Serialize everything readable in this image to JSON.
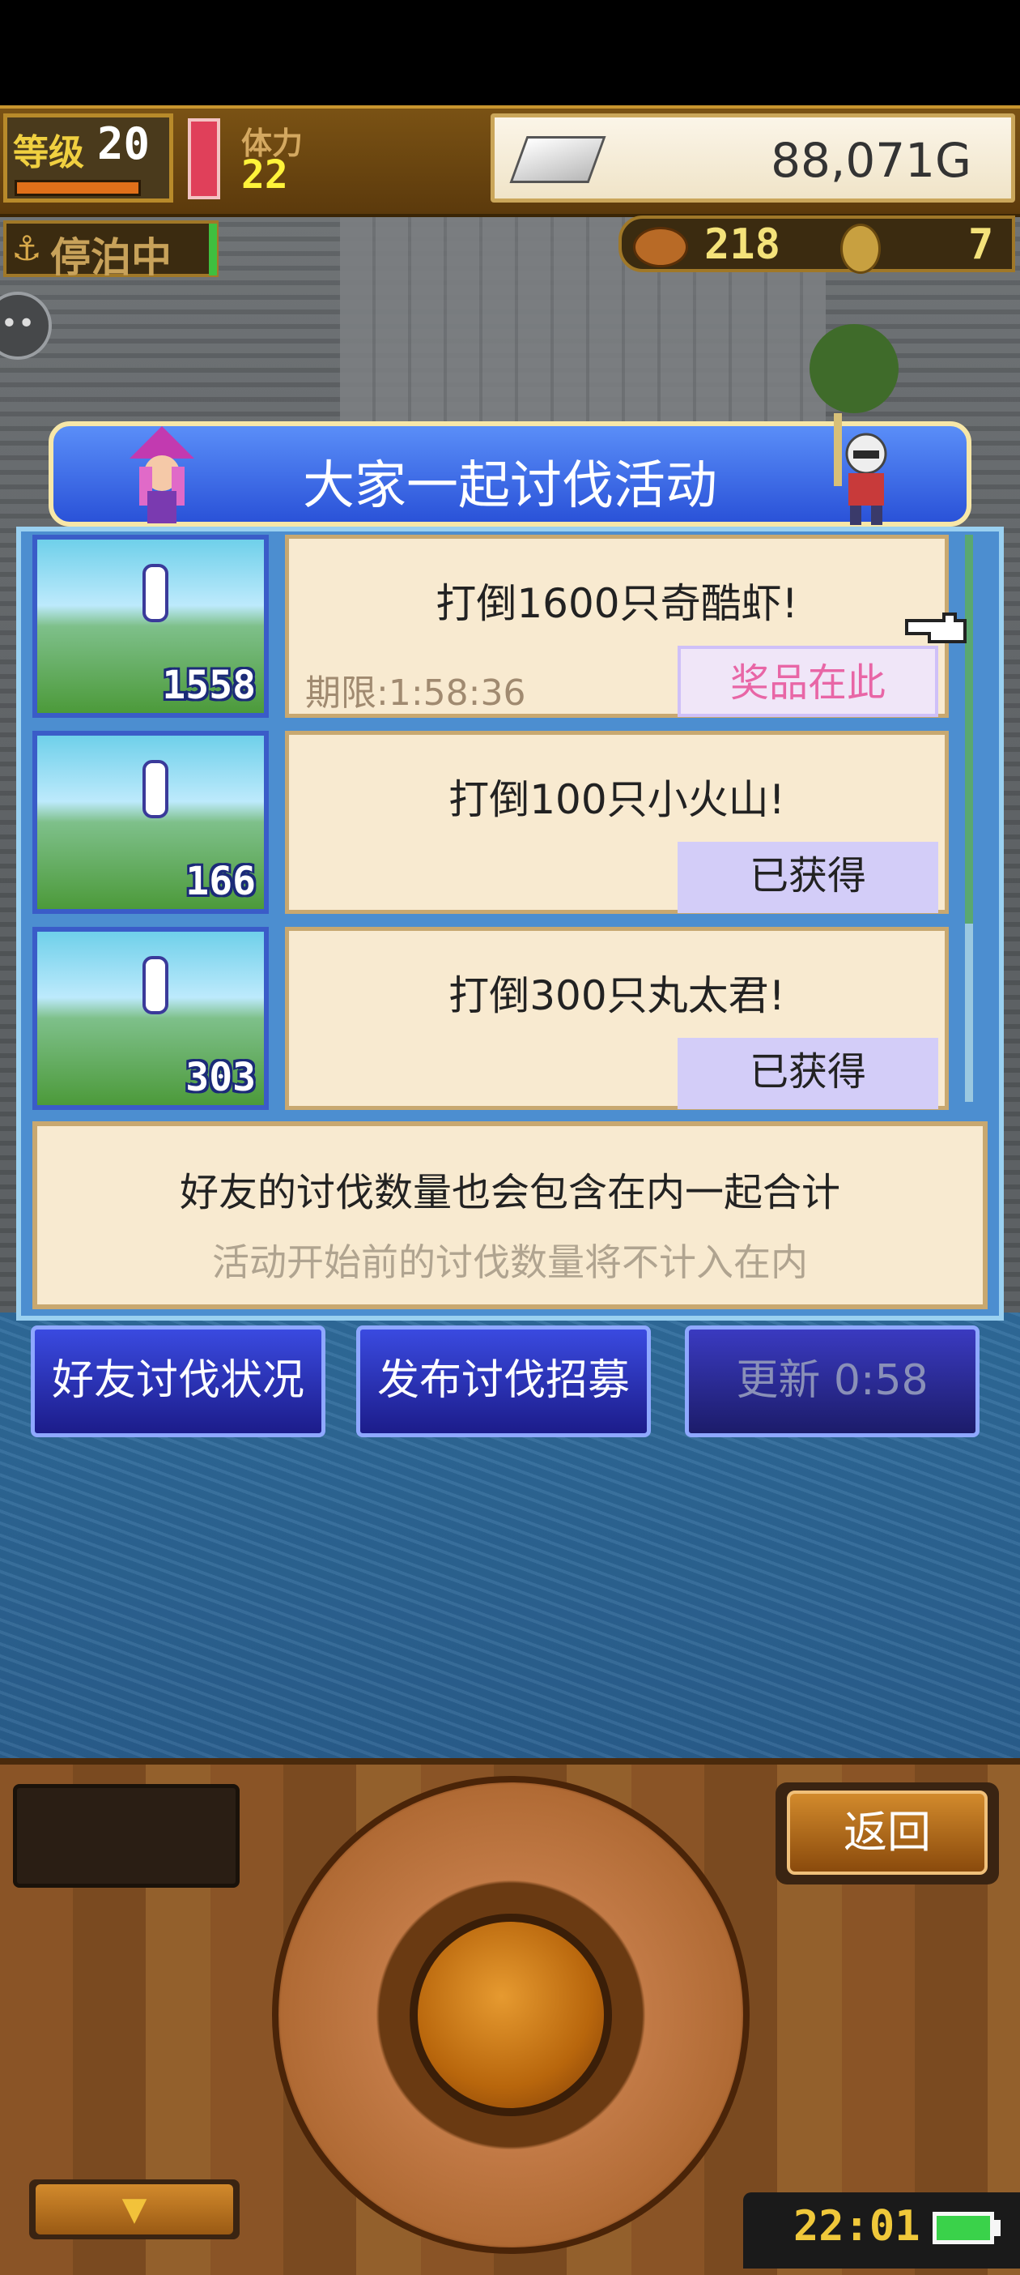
{
  "hud": {
    "level_label": "等级",
    "level": "20",
    "stamina_label": "体力",
    "stamina": "22",
    "gold": "88,071G",
    "status": "停泊中",
    "meat_count": "218",
    "medal_count": "7"
  },
  "dialog": {
    "title": "大家一起讨伐活动",
    "tasks": [
      {
        "text": "打倒1600只奇酷虾!",
        "count": "1558",
        "deadline": "期限:1:58:36",
        "badge": "奖品在此"
      },
      {
        "text": "打倒100只小火山!",
        "count": "166",
        "deadline": "",
        "badge": "已获得"
      },
      {
        "text": "打倒300只丸太君!",
        "count": "303",
        "deadline": "",
        "badge": "已获得"
      }
    ],
    "info_line1": "好友的讨伐数量也会包含在内一起合计",
    "info_line2": "活动开始前的讨伐数量将不计入在内",
    "buttons": {
      "friends_status": "好友讨伐状况",
      "post_recruit": "发布讨伐招募",
      "refresh": "更新 0:58"
    }
  },
  "console": {
    "back_label": "返回",
    "down_arrow": "▼",
    "clock": "22:01"
  },
  "icons": {
    "anchor": "⚓",
    "chat": "••"
  },
  "colors": {
    "title_blue": "#2a52d8",
    "prize_pink": "#e866a6",
    "badge_lavender": "#d3cdf8",
    "card_bg": "#f8ead0"
  }
}
